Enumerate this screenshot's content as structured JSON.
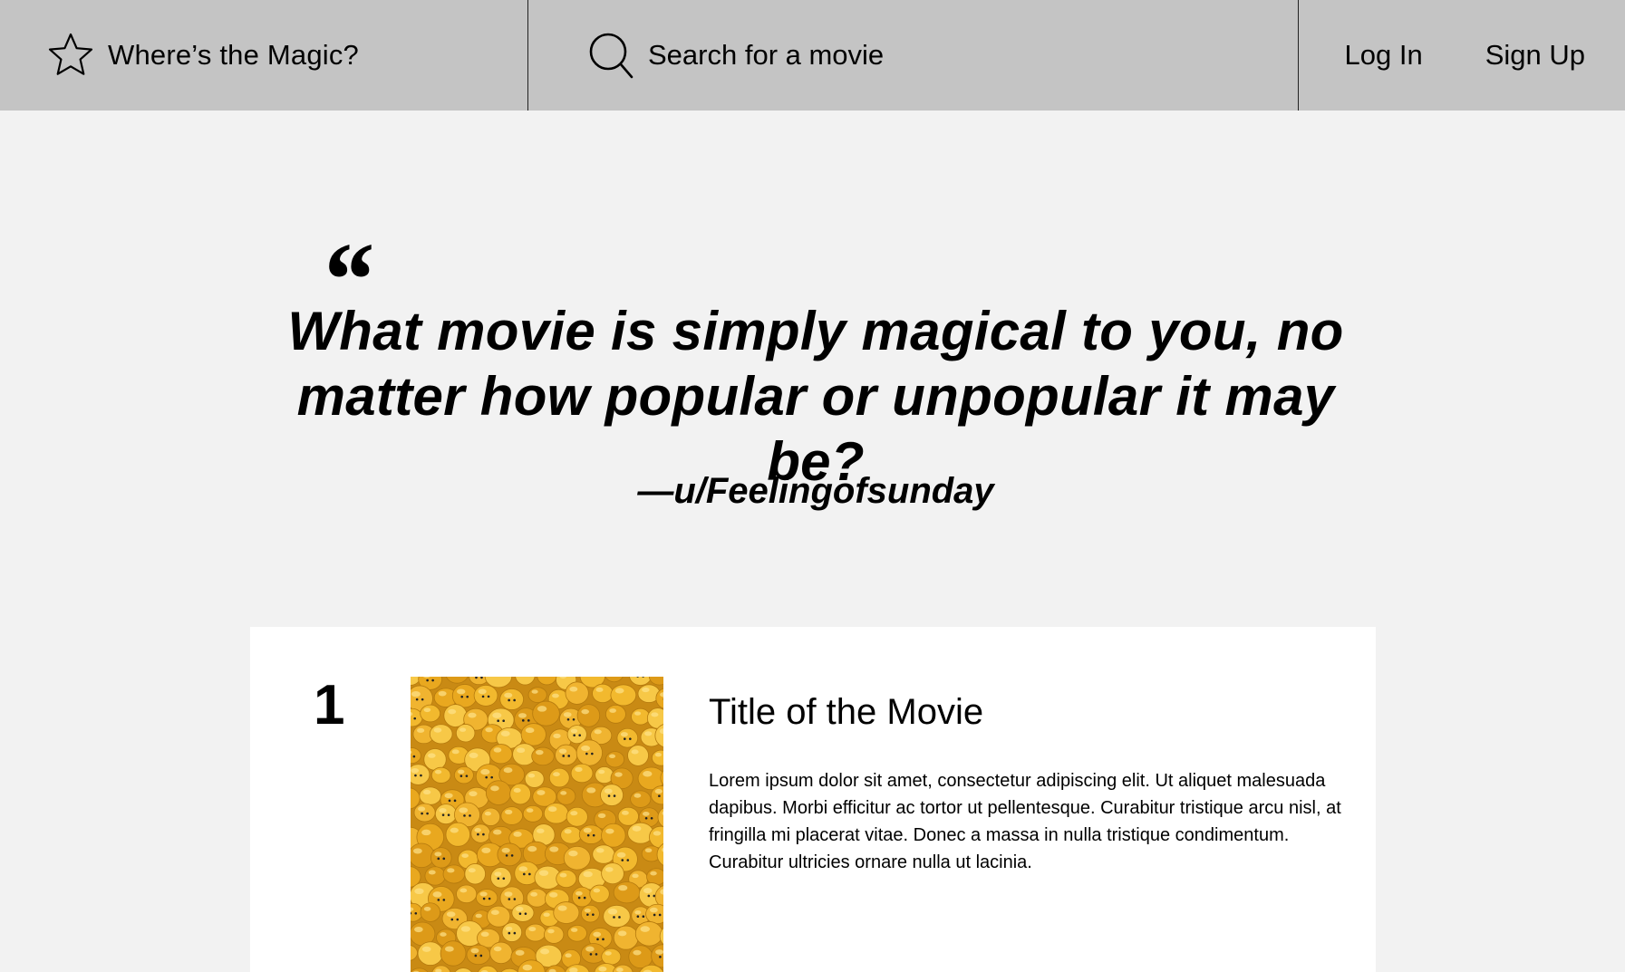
{
  "header": {
    "brand_name": "Where’s the Magic?",
    "brand_icon": "star-outline-icon",
    "search_icon": "search-icon",
    "search_placeholder": "Search for a movie",
    "login_label": "Log In",
    "signup_label": "Sign Up"
  },
  "quote": {
    "mark": "“",
    "text": "What movie is simply magical to you, no matter how popular or unpopular it may be?",
    "author": "—u/Feelingofsunday"
  },
  "movies": [
    {
      "rank": "1",
      "title": "Title of the Movie",
      "description": "Lorem ipsum dolor sit amet, consectetur adipiscing elit. Ut aliquet malesuada dapibus. Morbi efficitur ac tortor ut pellentesque. Curabitur tristique arcu nisl, at fringilla mi placerat vitae. Donec a massa in nulla tristique condimentum. Curabitur ultricies ornare nulla ut lacinia.",
      "poster": "yellow toy heads photo"
    }
  ],
  "colors": {
    "header_bg": "#c4c4c4",
    "page_bg": "#f2f2f2",
    "card_bg": "#ffffff",
    "poster_accent": "#e7ae22"
  }
}
